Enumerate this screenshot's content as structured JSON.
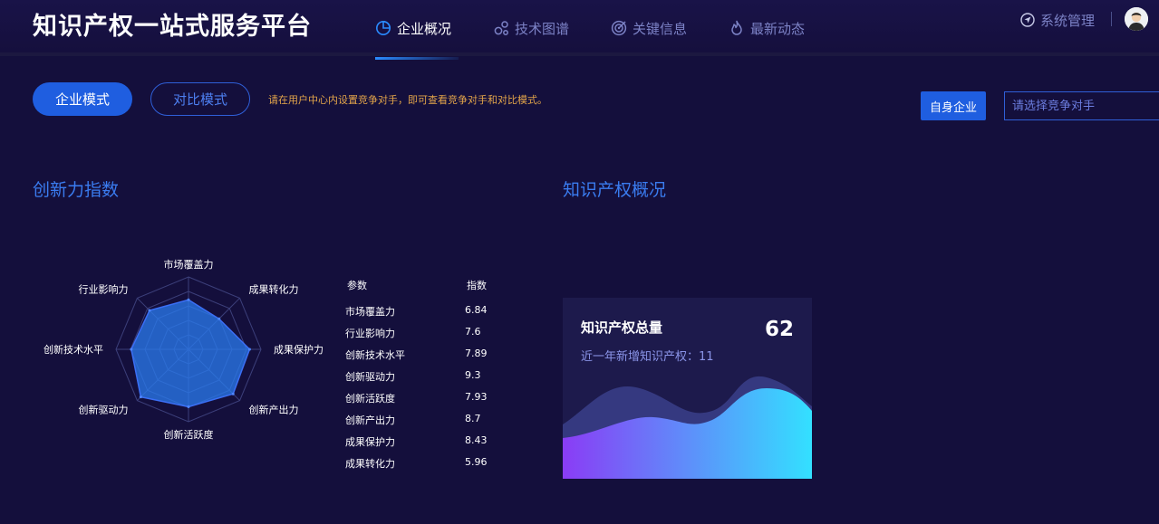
{
  "header": {
    "brand": "知识产权一站式服务平台",
    "nav": [
      {
        "label": "企业概况",
        "icon": "pie-chart-icon",
        "active": true
      },
      {
        "label": "技术图谱",
        "icon": "graph-nodes-icon",
        "active": false
      },
      {
        "label": "关键信息",
        "icon": "target-icon",
        "active": false
      },
      {
        "label": "最新动态",
        "icon": "flame-icon",
        "active": false
      }
    ],
    "system": "系统管理"
  },
  "toolbar": {
    "enterprise_mode": "企业模式",
    "compare_mode": "对比模式",
    "hint": "请在用户中心内设置竞争对手，即可查看竞争对手和对比模式。",
    "self_enterprise": "自身企业",
    "competitor_placeholder": "请选择竞争对手"
  },
  "innovation": {
    "title": "创新力指数",
    "table_header": {
      "param": "参数",
      "index": "指数"
    },
    "rows": [
      {
        "name": "市场覆盖力",
        "value": "6.84"
      },
      {
        "name": "行业影响力",
        "value": "7.6"
      },
      {
        "name": "创新技术水平",
        "value": "7.89"
      },
      {
        "name": "创新驱动力",
        "value": "9.3"
      },
      {
        "name": "创新活跃度",
        "value": "7.93"
      },
      {
        "name": "创新产出力",
        "value": "8.7"
      },
      {
        "name": "成果保护力",
        "value": "8.43"
      },
      {
        "name": "成果转化力",
        "value": "5.96"
      }
    ]
  },
  "chart_data": {
    "type": "radar",
    "axes": [
      "市场覆盖力",
      "成果转化力",
      "成果保护力",
      "创新产出力",
      "创新活跃度",
      "创新驱动力",
      "创新技术水平",
      "行业影响力"
    ],
    "values": [
      6.84,
      5.96,
      8.43,
      8.7,
      7.93,
      9.3,
      7.89,
      7.6
    ],
    "max": 10,
    "fill_color": "#2a7cf0"
  },
  "ip_overview": {
    "title": "知识产权概况",
    "card_title": "知识产权总量",
    "total": "62",
    "sub_label": "近一年新增知识产权：",
    "sub_value": "11"
  },
  "colors": {
    "accent": "#1f5ee0",
    "hint": "#e3a54a",
    "background": "#140f3c"
  }
}
